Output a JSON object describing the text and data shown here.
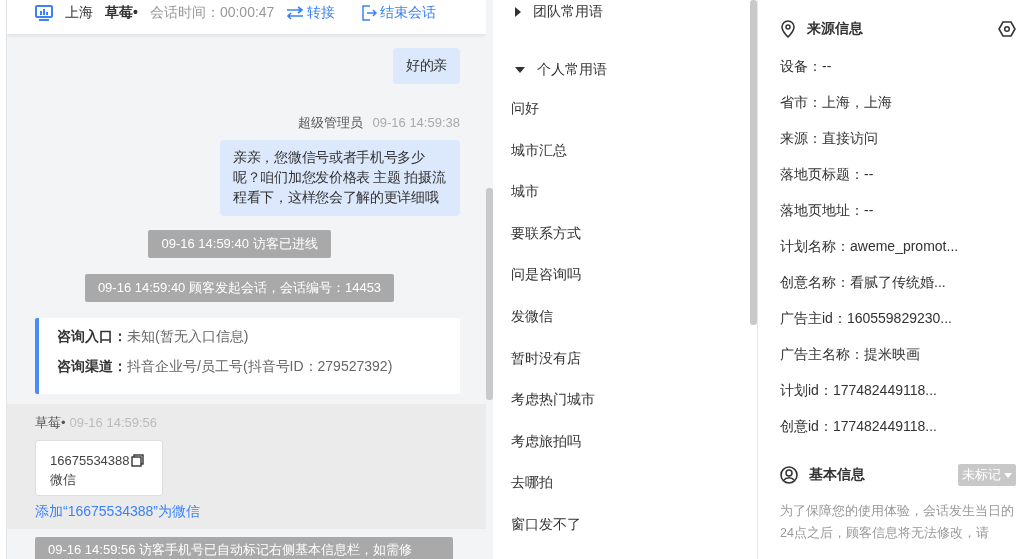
{
  "header": {
    "location": "上海",
    "visitor": "草莓•",
    "duration_label": "会话时间：",
    "duration": "00:00:47",
    "transfer": "转接",
    "end": "结束会话"
  },
  "messages": [
    {
      "kind": "agent",
      "text": "好的亲"
    },
    {
      "kind": "agent",
      "sender": "超级管理员",
      "time": "09-16 14:59:38",
      "text": "亲亲，您微信号或者手机号多少呢？咱们加您发价格表 主题 拍摄流程看下，这样您会了解的更详细哦"
    },
    {
      "kind": "system",
      "text": "09-16 14:59:40 访客已进线"
    },
    {
      "kind": "system",
      "text": "09-16 14:59:40 顾客发起会话，会话编号：14453"
    },
    {
      "kind": "entry",
      "rows": [
        {
          "label": "咨询入口：",
          "value": "未知(暂无入口信息)"
        },
        {
          "label": "咨询渠道：",
          "value": "抖音企业号/员工号(抖音号ID：279527392)"
        }
      ]
    },
    {
      "kind": "visitor",
      "sender": "草莓•",
      "time": "09-16 14:59:56",
      "card_number": "16675534388",
      "card_type": "微信",
      "link": "添加“16675534388”为微信"
    },
    {
      "kind": "system",
      "text": "09-16 14:59:56 访客手机号已自动标记右侧基本信息栏，如需修"
    }
  ],
  "phrase_groups": [
    {
      "title": "团队常用语",
      "expanded": false
    },
    {
      "title": "个人常用语",
      "expanded": true,
      "items": [
        "问好",
        "城市汇总",
        "城市",
        "要联系方式",
        "问是咨询吗",
        "发微信",
        "暂时没有店",
        "考虑热门城市",
        "考虑旅拍吗",
        "去哪拍",
        "窗口发不了"
      ]
    }
  ],
  "source_info": {
    "title": "来源信息",
    "rows": [
      "设备：--",
      "省市：上海，上海",
      "来源：直接访问",
      "落地页标题：--",
      "落地页地址：--",
      "计划名称：aweme_promot...",
      "创意名称：看腻了传统婚...",
      "广告主id：160559829230...",
      "广告主名称：提米映画",
      "计划id：177482449118...",
      "创意id：177482449118..."
    ]
  },
  "basic_info": {
    "title": "基本信息",
    "tag": "未标记",
    "note": "为了保障您的使用体验，会话发生当日的24点之后，顾客信息将无法修改，请"
  }
}
